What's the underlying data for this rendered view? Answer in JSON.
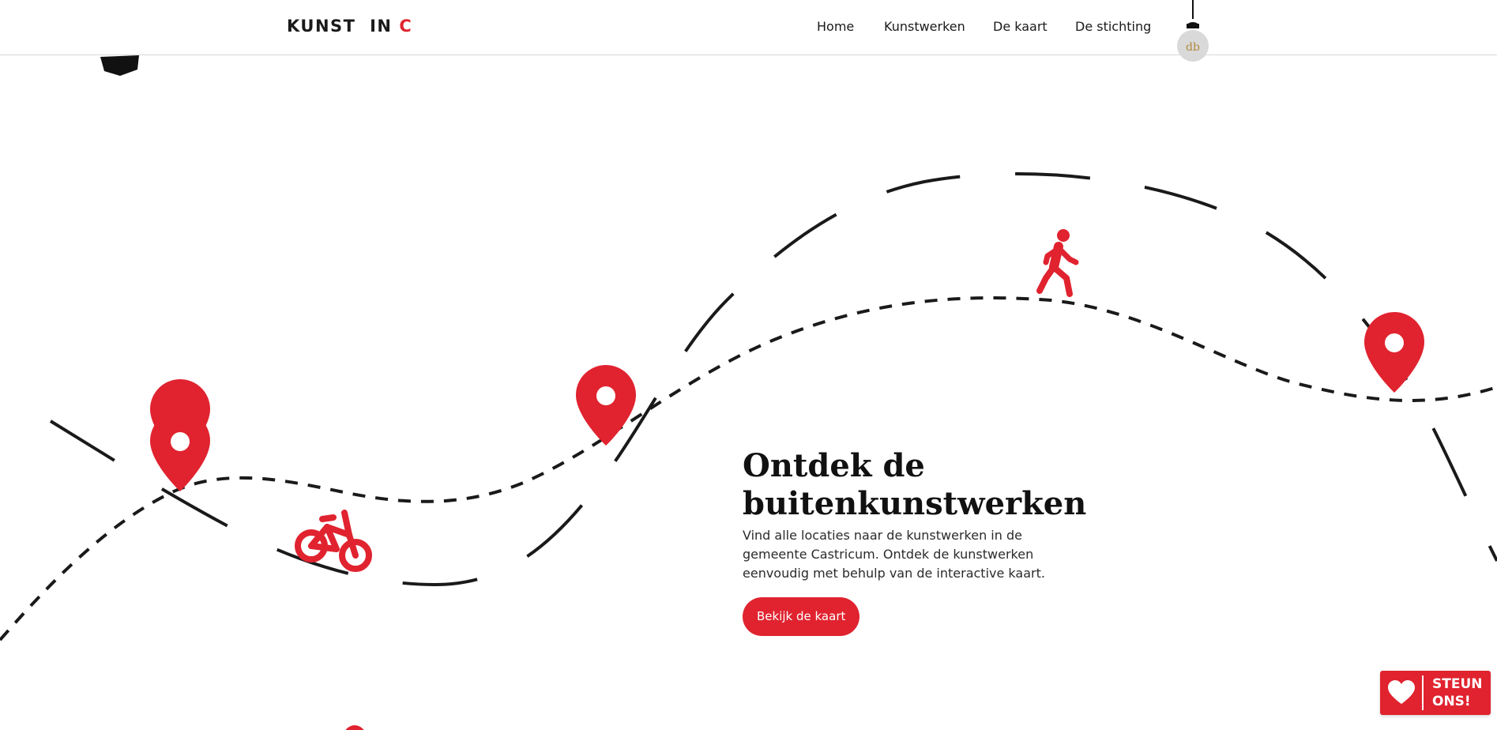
{
  "header": {
    "logo_main": "KUNST  IN ",
    "logo_accent": "C",
    "nav": [
      {
        "label": "Home"
      },
      {
        "label": "Kunstwerken"
      },
      {
        "label": "De kaart"
      },
      {
        "label": "De stichting"
      }
    ],
    "lamp_monogram": "db"
  },
  "hero": {
    "title_line1": "Ontdek de",
    "title_line2": "buitenkunstwerken",
    "description": "Vind alle locaties naar de kunstwerken in de gemeente Castricum. Ontdek de kunstwerken eenvoudig met behulp van de interactive kaart.",
    "button_label": "Bekijk de kaart"
  },
  "support": {
    "line1": "STEUN",
    "line2": "ONS!"
  },
  "colors": {
    "accent": "#e0232f",
    "text": "#1a1a1a",
    "background": "#ffffff"
  },
  "icons": [
    "map-pin-icon",
    "bicycle-icon",
    "walking-person-icon",
    "heart-icon",
    "lamp-icon"
  ]
}
